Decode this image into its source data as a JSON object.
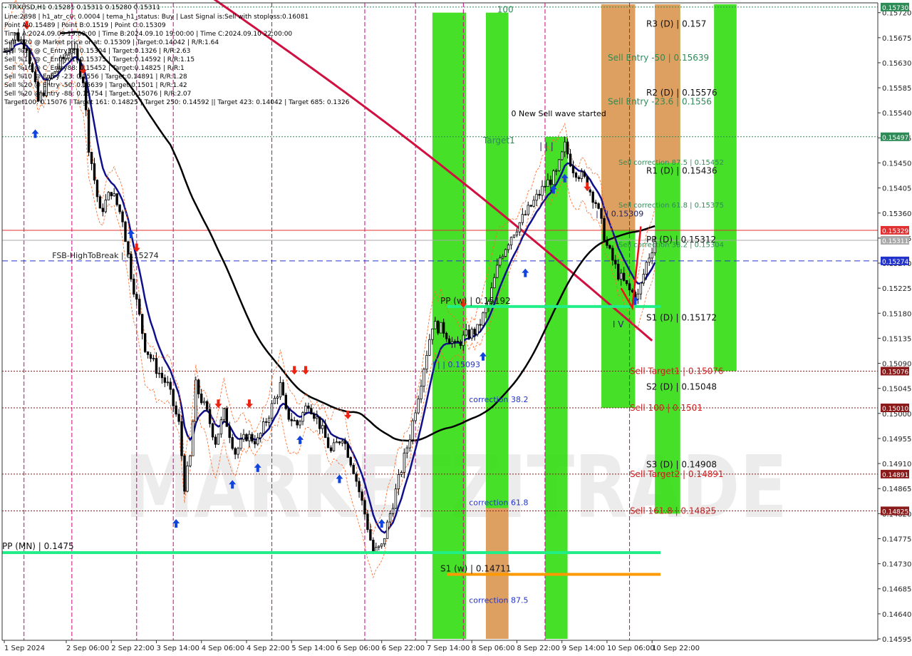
{
  "info": {
    "symbol_line": "- TRXUSD,H1  0.15281 0.15311 0.15280 0.15311",
    "lines": [
      "Line:2898 | h1_atr_c0: 0.0004 | tema_h1_status: Buy | Last Signal is:Sell with stoploss:0.16081",
      "Point A:0.15489 | Point B:0.1519 | Point C:0.15309",
      "Time A:2024.09.09 19:00:00 | Time B:2024.09.10 19:00:00 | Time C:2024.09.10 22:00:00",
      "Sell %20 @ Market price or at: 0.15309 | Target:0.14042 | R/R:1.64",
      "Sell %10 @ C_Entry38: 0.15304 | Target:0.1326 | R/R:2.63",
      "Sell %10 @ C_Entry61: 0.15375 | Target:0.14592 | R/R:1.15",
      "Sell %10 @ C_Entry88: 0.15452 | Target:0.14825 | R/R:1",
      "Sell %10 @ Entry -23: 0.1556 | Target:0.14891 | R/R:1.28",
      "Sell %20 @ Entry -50: 0.15639 | Target:0.1501 | R/R:1.42",
      "Sell %20 @ Entry -88: 0.15754 | Target:0.15076 | R/R:2.07",
      "Target100: 0.15076 | Target 161: 0.14825 | Target 250: 0.14592 || Target 423: 0.14042 | Target 685: 0.1326"
    ]
  },
  "chart_data": {
    "type": "candlestick",
    "symbol": "TRXUSD",
    "timeframe": "H1",
    "ylim": [
      0.14595,
      0.15735
    ],
    "y_ticks": [
      "0.15720",
      "0.15675",
      "0.15630",
      "0.15585",
      "0.15540",
      "0.15495",
      "0.15450",
      "0.15405",
      "0.15360",
      "0.15315",
      "0.15270",
      "0.15225",
      "0.15180",
      "0.15135",
      "0.15090",
      "0.15045",
      "0.15000",
      "0.14955",
      "0.14910",
      "0.14865",
      "0.14820",
      "0.14775",
      "0.14730",
      "0.14685",
      "0.14640",
      "0.14595"
    ],
    "x_ticks": [
      {
        "label": "1 Sep 2024",
        "index": 0
      },
      {
        "label": "2 Sep 06:00",
        "index": 22
      },
      {
        "label": "2 Sep 22:00",
        "index": 38
      },
      {
        "label": "3 Sep 14:00",
        "index": 54
      },
      {
        "label": "4 Sep 06:00",
        "index": 70
      },
      {
        "label": "4 Sep 22:00",
        "index": 86
      },
      {
        "label": "5 Sep 14:00",
        "index": 102
      },
      {
        "label": "6 Sep 06:00",
        "index": 118
      },
      {
        "label": "6 Sep 22:00",
        "index": 134
      },
      {
        "label": "7 Sep 14:00",
        "index": 150
      },
      {
        "label": "8 Sep 06:00",
        "index": 166
      },
      {
        "label": "8 Sep 22:00",
        "index": 182
      },
      {
        "label": "9 Sep 14:00",
        "index": 198
      },
      {
        "label": "10 Sep 06:00",
        "index": 214
      },
      {
        "label": "10 Sep 22:00",
        "index": 230
      }
    ],
    "close_path": [
      [
        0,
        0.1565
      ],
      [
        4,
        0.1568
      ],
      [
        8,
        0.1566
      ],
      [
        12,
        0.1556
      ],
      [
        16,
        0.156
      ],
      [
        20,
        0.1563
      ],
      [
        24,
        0.1566
      ],
      [
        28,
        0.156
      ],
      [
        30,
        0.1548
      ],
      [
        34,
        0.1536
      ],
      [
        38,
        0.154
      ],
      [
        42,
        0.1535
      ],
      [
        45,
        0.1525
      ],
      [
        47,
        0.152
      ],
      [
        50,
        0.1512
      ],
      [
        54,
        0.1508
      ],
      [
        58,
        0.1505
      ],
      [
        62,
        0.1498
      ],
      [
        64,
        0.1487
      ],
      [
        66,
        0.1492
      ],
      [
        68,
        0.1505
      ],
      [
        72,
        0.15
      ],
      [
        75,
        0.1495
      ],
      [
        78,
        0.15
      ],
      [
        82,
        0.1493
      ],
      [
        86,
        0.1496
      ],
      [
        90,
        0.1495
      ],
      [
        94,
        0.15
      ],
      [
        98,
        0.1505
      ],
      [
        100,
        0.15
      ],
      [
        104,
        0.1498
      ],
      [
        108,
        0.1502
      ],
      [
        112,
        0.1498
      ],
      [
        116,
        0.1493
      ],
      [
        120,
        0.1496
      ],
      [
        124,
        0.149
      ],
      [
        128,
        0.1482
      ],
      [
        131,
        0.1475
      ],
      [
        134,
        0.1476
      ],
      [
        137,
        0.1482
      ],
      [
        140,
        0.1488
      ],
      [
        144,
        0.1496
      ],
      [
        148,
        0.1506
      ],
      [
        152,
        0.1516
      ],
      [
        156,
        0.1515
      ],
      [
        160,
        0.1512
      ],
      [
        164,
        0.1514
      ],
      [
        168,
        0.1515
      ],
      [
        172,
        0.152
      ],
      [
        176,
        0.1528
      ],
      [
        180,
        0.1532
      ],
      [
        184,
        0.1535
      ],
      [
        188,
        0.1538
      ],
      [
        192,
        0.1541
      ],
      [
        196,
        0.1543
      ],
      [
        199,
        0.1548
      ],
      [
        202,
        0.1544
      ],
      [
        206,
        0.1542
      ],
      [
        210,
        0.1538
      ],
      [
        214,
        0.153
      ],
      [
        218,
        0.1525
      ],
      [
        222,
        0.1522
      ],
      [
        225,
        0.1521
      ],
      [
        228,
        0.1527
      ],
      [
        231,
        0.15311
      ]
    ],
    "n_candles": 231,
    "horizontal_lines": [
      {
        "price": 0.1573,
        "style": "dotted",
        "color": "#2e8b57",
        "tag": "0.15730"
      },
      {
        "price": 0.15497,
        "style": "dotted",
        "color": "#2e8b57",
        "tag": "0.15497"
      },
      {
        "price": 0.15329,
        "style": "solid",
        "color": "#e03030",
        "tag": "0.15329"
      },
      {
        "price": 0.15311,
        "style": "solid",
        "color": "#aaaaaa",
        "tag": "0.15311"
      },
      {
        "price": 0.15274,
        "style": "dashed",
        "color": "#2233cc",
        "tag": "0.15274"
      },
      {
        "price": 0.15076,
        "style": "dotted",
        "color": "#8b1a1a",
        "tag": "0.15076"
      },
      {
        "price": 0.1501,
        "style": "dotted",
        "color": "#8b1a1a",
        "tag": "0.15010"
      },
      {
        "price": 0.14891,
        "style": "dotted",
        "color": "#8b1a1a",
        "tag": "0.14891"
      },
      {
        "price": 0.14825,
        "style": "dotted",
        "color": "#8b1a1a",
        "tag": "0.14825"
      }
    ],
    "pivot_lines": [
      {
        "label": "PP (MN) | 0.1475",
        "price": 0.1475,
        "from": 0,
        "to": 233,
        "color": "#22ee88"
      },
      {
        "label": "S1 (w) | 0.14711",
        "price": 0.14711,
        "from": 158,
        "to": 233,
        "color": "#ff9900"
      },
      {
        "label": "PP (w) | 0.15192",
        "price": 0.15192,
        "from": 158,
        "to": 233,
        "color": "#22ee88"
      }
    ],
    "daily_levels": [
      {
        "label": "R3 (D) | 0.157",
        "price": 0.157
      },
      {
        "label": "R2 (D) | 0.15576",
        "price": 0.15576
      },
      {
        "label": "R1 (D) | 0.15436",
        "price": 0.15436
      },
      {
        "label": "PP (D) | 0.15312",
        "price": 0.15312
      },
      {
        "label": "S1 (D) | 0.15172",
        "price": 0.15172
      },
      {
        "label": "S2 (D) | 0.15048",
        "price": 0.15048
      },
      {
        "label": "S3 (D) | 0.14908",
        "price": 0.14908
      }
    ],
    "sell_levels": [
      {
        "label": "Sell Entry -50 | 0.15639",
        "price": 0.15639,
        "color": "#2e8b57"
      },
      {
        "label": "Sell Entry -23.6 | 0.1556",
        "price": 0.1556,
        "color": "#2e8b57"
      },
      {
        "label": "Sell correction 87.5 | 0.15452",
        "price": 0.15452,
        "color": "#2e8b57"
      },
      {
        "label": "Sell correction 61.8 | 0.15375",
        "price": 0.15375,
        "color": "#2e8b57"
      },
      {
        "label": "Sell correction 38.2 | 0.15304",
        "price": 0.15304,
        "color": "#2e8b57"
      },
      {
        "label": "Sell Target1 | 0.15076",
        "price": 0.15076,
        "color": "#cc2222"
      },
      {
        "label": "Sell 100 | 0.1501",
        "price": 0.1501,
        "color": "#cc2222"
      },
      {
        "label": "Sell Target2 | 0.14891",
        "price": 0.14891,
        "color": "#cc2222"
      },
      {
        "label": "Sell 161.8 | 0.14825",
        "price": 0.14825,
        "color": "#cc2222"
      }
    ],
    "annotations": [
      {
        "text": "FSB-HighToBreak | 0.15274",
        "x": 17,
        "price": 0.15279,
        "color": "#222222"
      },
      {
        "text": "0 New Sell wave started",
        "x": 180,
        "price": 0.15534,
        "color": "#000000"
      },
      {
        "text": "Target1",
        "x": 170,
        "price": 0.15485,
        "color": "#2e8b57"
      },
      {
        "text": "100",
        "x": 175,
        "price": 0.1572,
        "color": "#2e8b57"
      },
      {
        "text": "| | | 0.15309",
        "x": 210,
        "price": 0.15354,
        "color": "#222266"
      },
      {
        "text": "| | | 0.15093",
        "x": 152,
        "price": 0.15083,
        "color": "#2233cc"
      },
      {
        "text": "correction 38.2",
        "x": 165,
        "price": 0.1502,
        "color": "#2233cc"
      },
      {
        "text": "correction 61.8",
        "x": 165,
        "price": 0.14835,
        "color": "#2233cc"
      },
      {
        "text": "correction 87.5",
        "x": 165,
        "price": 0.1466,
        "color": "#2233cc"
      },
      {
        "text": "I V",
        "x": 216,
        "price": 0.15155,
        "color": "#222266"
      },
      {
        "text": "| | |",
        "x": 190,
        "price": 0.15475,
        "color": "#222266"
      }
    ],
    "zones": [
      {
        "x0": 152,
        "x1": 164,
        "y0": 0.1572,
        "y1": 0.14595,
        "color": "#33dd11"
      },
      {
        "x0": 171,
        "x1": 179,
        "y0": 0.1572,
        "y1": 0.14595,
        "color": "#33dd11"
      },
      {
        "x0": 171,
        "x1": 179,
        "y0": 0.1483,
        "y1": 0.14595,
        "color": "#ee9966"
      },
      {
        "x0": 192,
        "x1": 200,
        "y0": 0.15497,
        "y1": 0.14595,
        "color": "#33dd11"
      },
      {
        "x0": 212,
        "x1": 224,
        "y0": 0.15735,
        "y1": 0.1501,
        "color": "#33dd11"
      },
      {
        "x0": 212,
        "x1": 224,
        "y0": 0.15735,
        "y1": 0.1533,
        "color": "#ee9966"
      },
      {
        "x0": 231,
        "x1": 240,
        "y0": 0.15735,
        "y1": 0.1482,
        "color": "#33dd11"
      },
      {
        "x0": 231,
        "x1": 240,
        "y0": 0.15735,
        "y1": 0.1545,
        "color": "#ee9966"
      },
      {
        "x0": 252,
        "x1": 260,
        "y0": 0.15735,
        "y1": 0.15076,
        "color": "#33dd11"
      }
    ],
    "vlines": [
      7,
      24,
      47,
      60,
      95,
      128,
      146,
      163,
      192,
      222
    ],
    "watermark": "MARKETZITRADE",
    "colors": {
      "bull": "#22aa22",
      "bear": "#000000",
      "ema_long": "#d01040",
      "sma": "#000000",
      "tema": "#10108a",
      "channel": "#ff6622",
      "vline": "#cc0088",
      "axis": "#333333"
    }
  }
}
